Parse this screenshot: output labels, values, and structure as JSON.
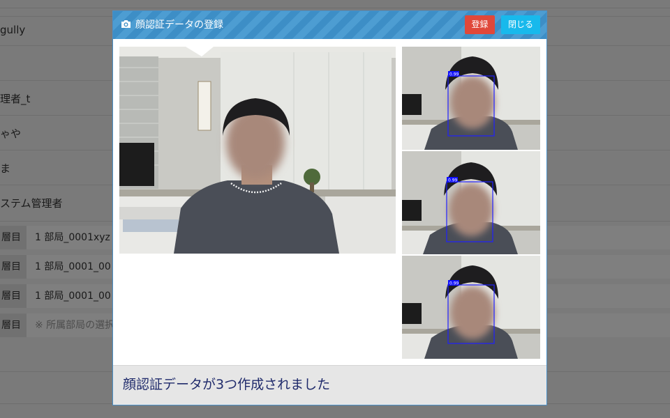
{
  "background": {
    "rows": [
      {
        "text": "gully"
      },
      {
        "text": ""
      },
      {
        "text": "理者_t"
      },
      {
        "text": "ゃや"
      },
      {
        "text": "ま"
      },
      {
        "text": "ステム管理者"
      }
    ],
    "grid": [
      {
        "label": "層目",
        "value": "1 部局_0001xyz"
      },
      {
        "label": "層目",
        "value": "1 部局_0001_00"
      },
      {
        "label": "層目",
        "value": "1 部局_0001_00"
      },
      {
        "label": "層目",
        "value": "※ 所属部局の選択"
      }
    ]
  },
  "modal": {
    "title": "顔認証データの登録",
    "register_label": "登録",
    "close_label": "閉じる",
    "status_message": "顔認証データが3つ作成されました",
    "detections": [
      {
        "confidence": "0.99"
      },
      {
        "confidence": "0.99"
      },
      {
        "confidence": "0.99"
      }
    ]
  },
  "colors": {
    "header": "#3d8ec6",
    "register_button": "#e0483a",
    "close_button": "#18b9ec",
    "status_text": "#1f2a6b",
    "detection_box": "#2020ff"
  },
  "icons": {
    "header_icon": "camera-icon"
  }
}
